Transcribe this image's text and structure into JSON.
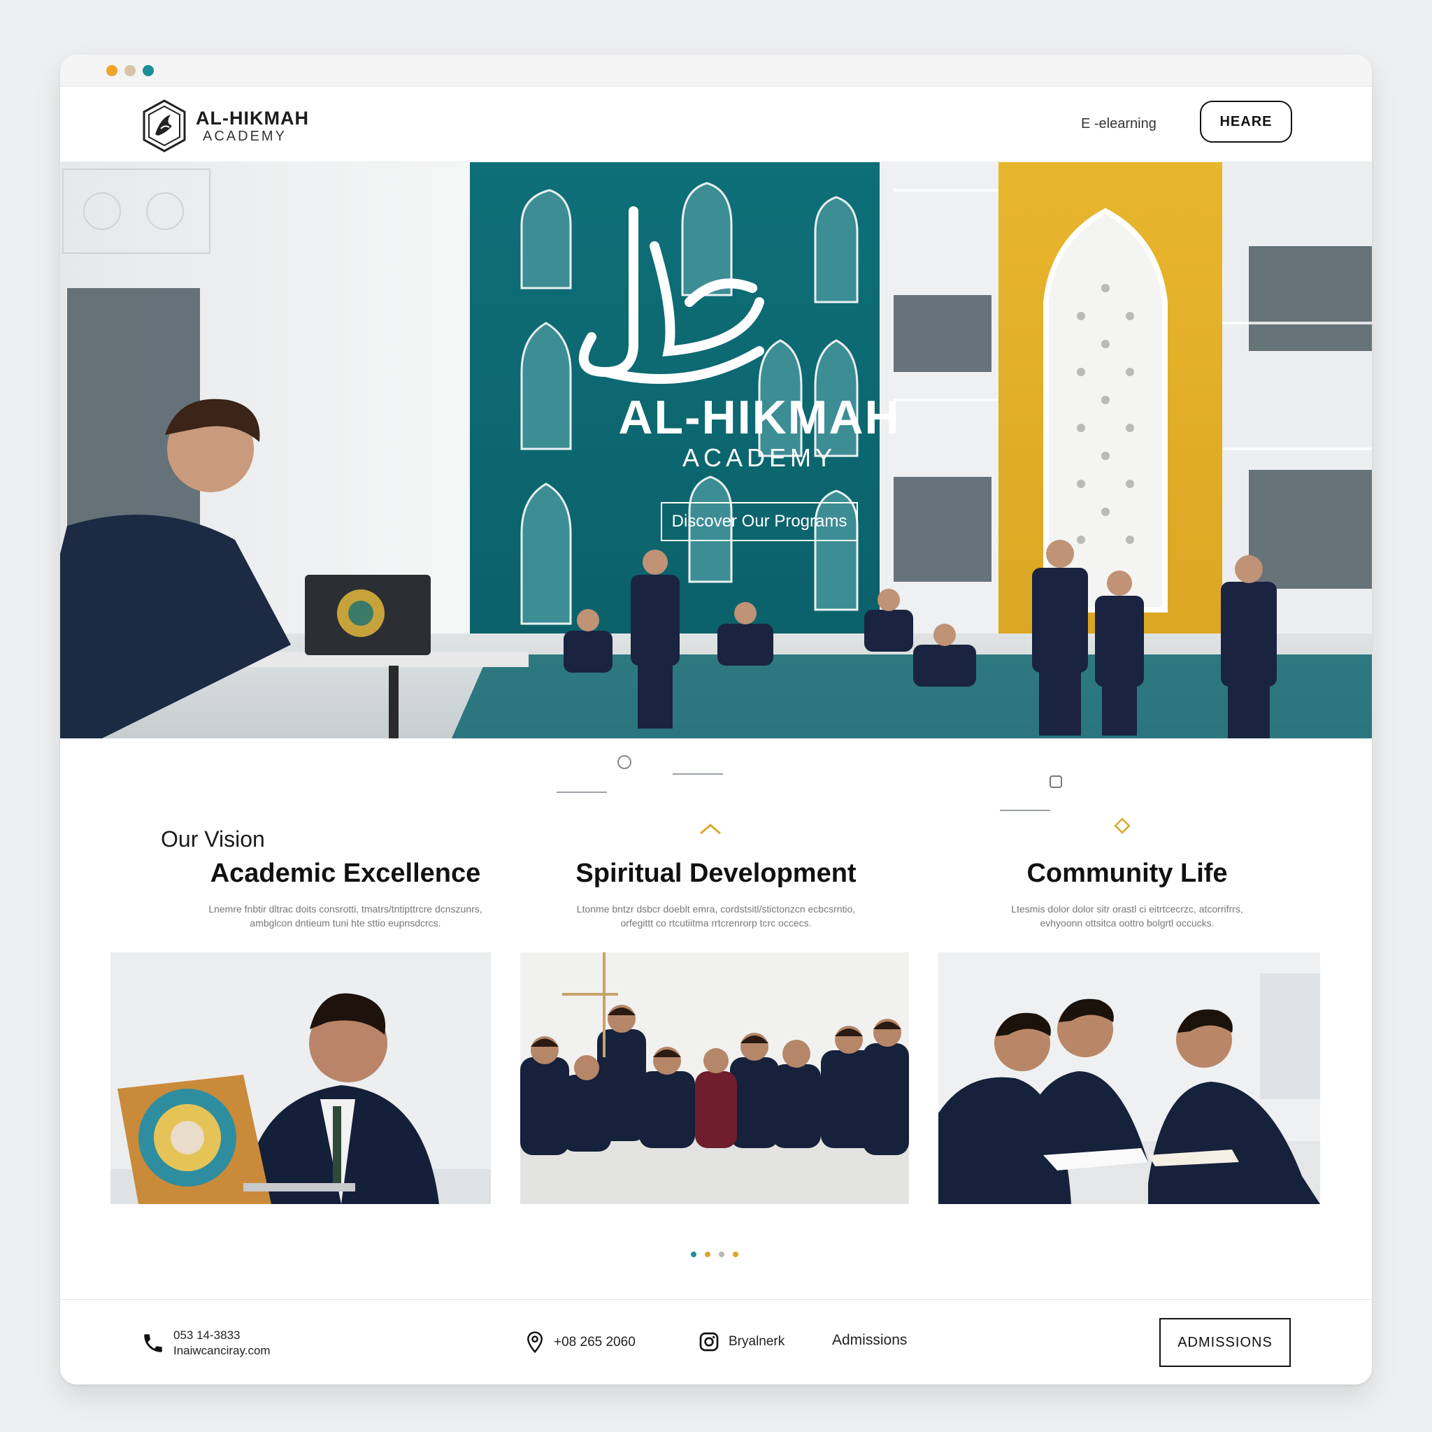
{
  "colors": {
    "teal": "#0e6f78",
    "gold": "#e8b62d",
    "ink": "#111111"
  },
  "window": {
    "dots": [
      "#f1a32a",
      "#d8c3a8",
      "#1d8d96"
    ]
  },
  "header": {
    "logo_name": "AL-HIKMAH",
    "logo_sub": "ACADEMY",
    "nav_link": "E -elearning",
    "nav_button": "HEARE"
  },
  "hero": {
    "title": "AL-HIKMAH",
    "subtitle": "ACADEMY",
    "cta": "Discover Our Programs"
  },
  "vision": {
    "label": "Our Vision",
    "columns": [
      {
        "title": "Academic Excellence",
        "desc_line1": "Lnemre fnbtir dltrac doits consrotti, tmatrs/tntipttrcre dcnszunrs,",
        "desc_line2": "ambglcon dntieum tuni hte sttio eupnsdcrcs."
      },
      {
        "title": "Spiritual Development",
        "desc_line1": "Ltonme bntzr dsbcr doeblt emra, cordstsitl/stictonzcn ecbcsrntio,",
        "desc_line2": "orfegittt co rtcutiitma rrtcrenrorp tcrc occecs."
      },
      {
        "title": "Community Life",
        "desc_line1": "Ltesmis dolor dolor sitr orastl ci eitrtcecrzc, atcorrifrrs,",
        "desc_line2": "evhyoonn ottsitca oottro bolgrtl occucks."
      }
    ]
  },
  "photos": [
    "student-laptop-photo",
    "students-group-floor-photo",
    "students-studying-photo"
  ],
  "footer": {
    "phone": "053 14-3833",
    "email": "Inaiwcanciray.com",
    "location_phone": "+08 265 2060",
    "social": "Bryalnerk",
    "admissions_link": "Admissions",
    "admissions_button": "ADMISSIONS"
  }
}
